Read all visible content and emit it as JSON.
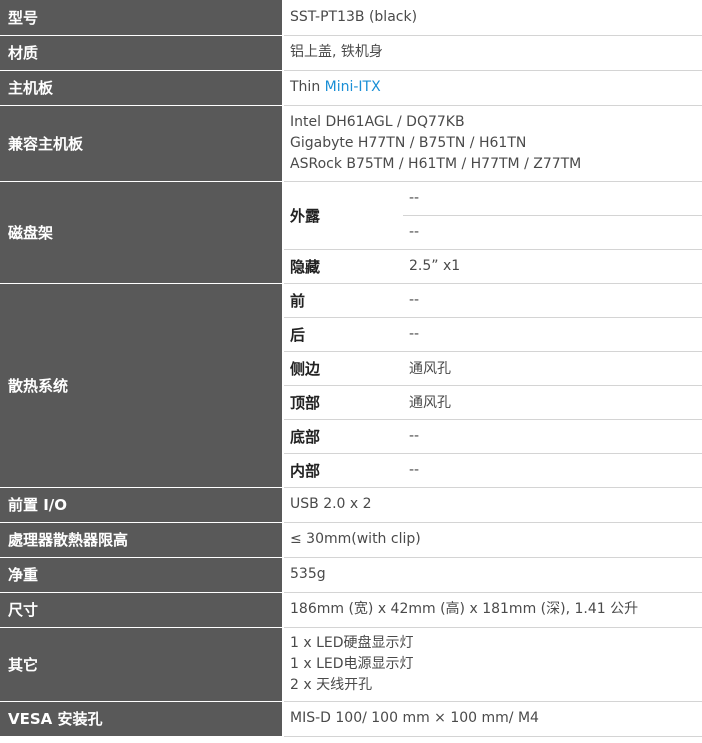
{
  "rows": {
    "model": {
      "label": "型号",
      "value": "SST-PT13B (black)"
    },
    "material": {
      "label": "材质",
      "value": "铝上盖, 铁机身"
    },
    "motherboard": {
      "label": "主机板",
      "prefix": "Thin ",
      "link": "Mini-ITX"
    },
    "compat": {
      "label": "兼容主机板",
      "lines": [
        "Intel DH61AGL / DQ77KB",
        "Gigabyte H77TN / B75TN / H61TN",
        "ASRock B75TM / H61TM / H77TM / Z77TM"
      ]
    },
    "drive_bay": {
      "label": "磁盘架",
      "external_label": "外露",
      "external_values": [
        "--",
        "--"
      ],
      "hidden_label": "隐藏",
      "hidden_value": "2.5” x1"
    },
    "cooling": {
      "label": "散热系统",
      "items": [
        {
          "label": "前",
          "value": "--"
        },
        {
          "label": "后",
          "value": "--"
        },
        {
          "label": "侧边",
          "value": "通风孔"
        },
        {
          "label": "顶部",
          "value": "通风孔"
        },
        {
          "label": "底部",
          "value": "--"
        },
        {
          "label": "内部",
          "value": "--"
        }
      ]
    },
    "front_io": {
      "label": "前置 I/O",
      "value": "USB 2.0 x 2"
    },
    "cpu_cooler": {
      "label": "處理器散熱器限高",
      "value": "≤ 30mm(with clip)"
    },
    "weight": {
      "label": "净重",
      "value": "535g"
    },
    "dimensions": {
      "label": "尺寸",
      "value": "186mm (宽) x 42mm (高) x 181mm (深), 1.41 公升"
    },
    "other": {
      "label": "其它",
      "lines": [
        "1 x LED硬盘显示灯",
        "1 x LED电源显示灯",
        "2 x 天线开孔"
      ]
    },
    "vesa": {
      "label": "VESA 安装孔",
      "value": "MIS-D 100/ 100 mm × 100 mm/ M4"
    }
  },
  "colors": {
    "label_bg": "#595959",
    "link": "#1a8fd6",
    "divider": "#d4d4d4"
  }
}
